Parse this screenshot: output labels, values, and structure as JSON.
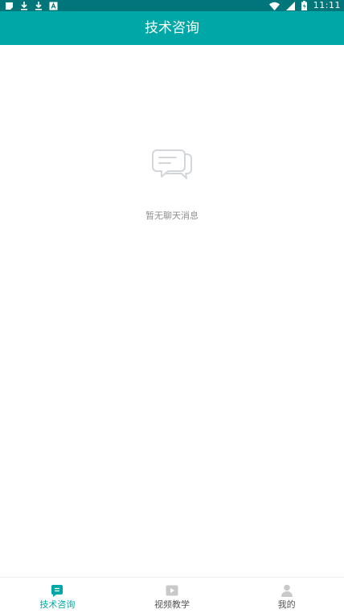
{
  "status_bar": {
    "time": "11:11",
    "left_icons": [
      "notification-square-icon",
      "download-icon",
      "download-icon",
      "text-a-icon"
    ],
    "right_icons": [
      "wifi-icon",
      "signal-icon",
      "battery-icon"
    ]
  },
  "app_bar": {
    "title": "技术咨询"
  },
  "empty_state": {
    "icon": "chat-bubbles-icon",
    "message": "暂无聊天消息"
  },
  "tab_bar": {
    "items": [
      {
        "label": "技术咨询",
        "icon": "chat-icon",
        "active": true
      },
      {
        "label": "视频教学",
        "icon": "video-play-icon",
        "active": false
      },
      {
        "label": "我的",
        "icon": "person-icon",
        "active": false
      }
    ]
  },
  "colors": {
    "accent": "#00a7a7",
    "status_bar": "#00767a",
    "inactive_icon": "#c9c9c9",
    "empty_text": "#8f8f8f"
  }
}
